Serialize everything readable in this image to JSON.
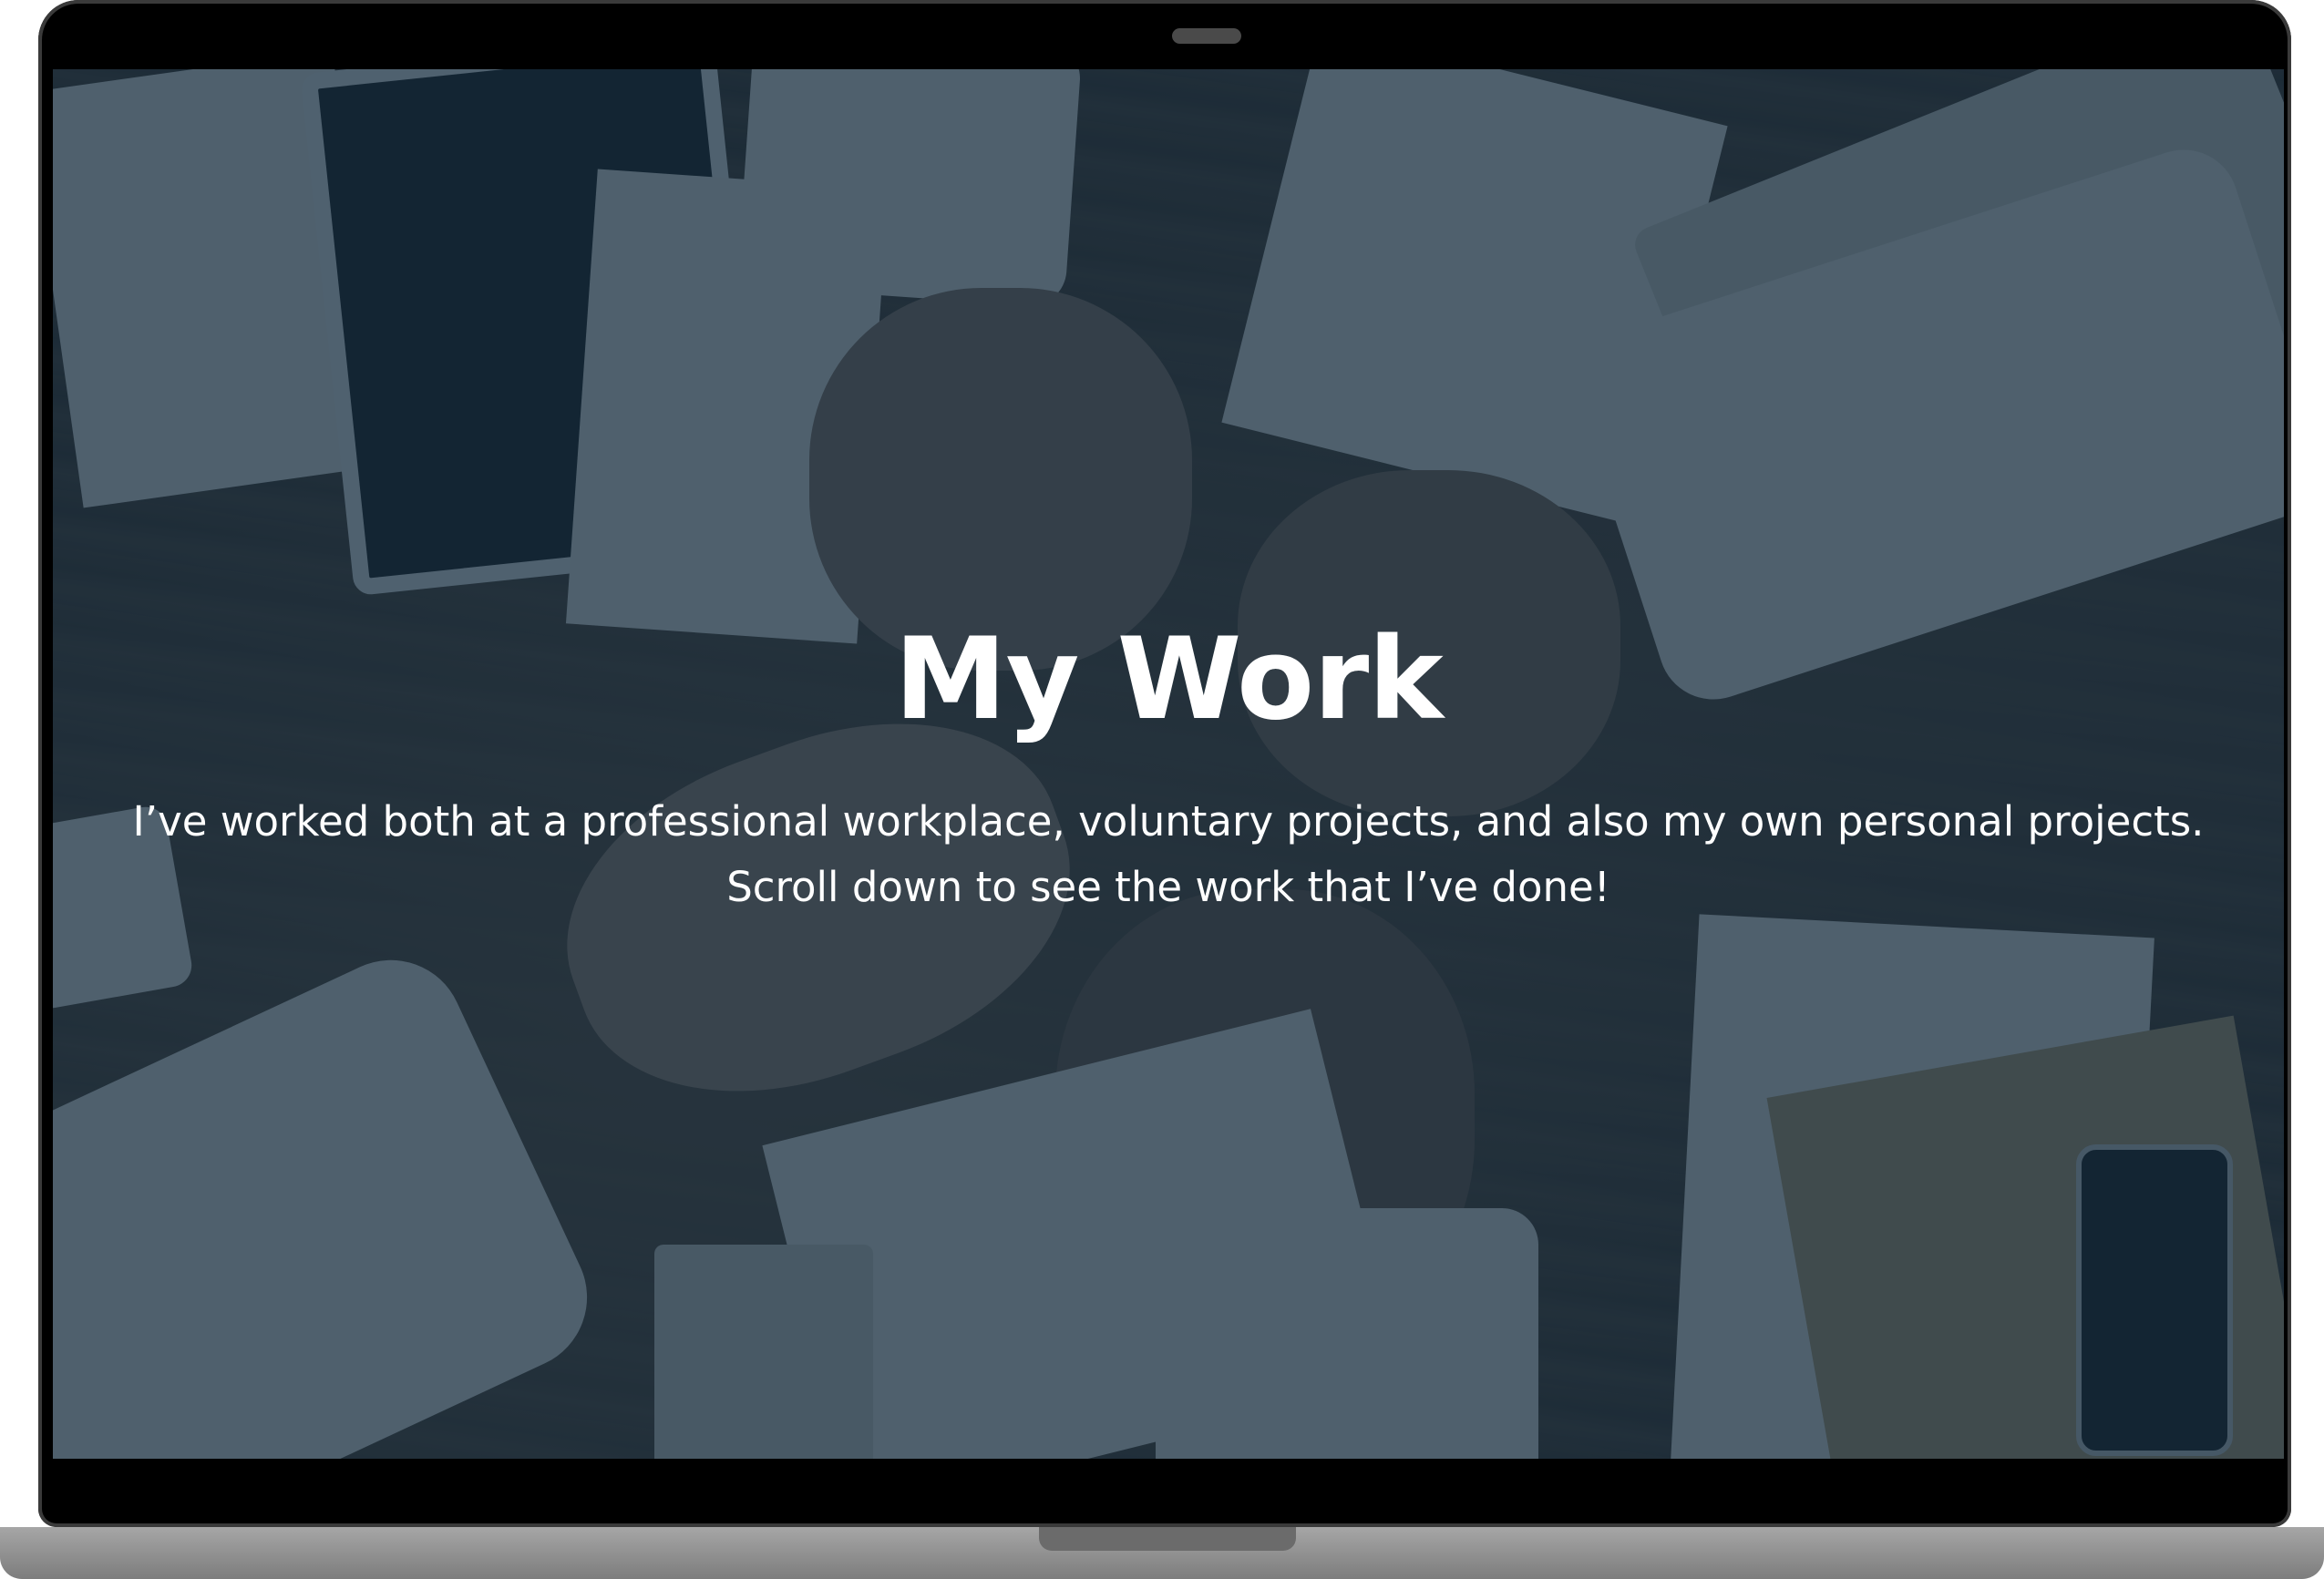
{
  "hero": {
    "title": "My Work",
    "subtitle_line1": "I’ve worked both at a professional workplace, voluntary projects, and also my own personal projects.",
    "subtitle_line2": "Scroll down to see the work that I’ve done!"
  },
  "colors": {
    "overlay": "#142c40",
    "bezel": "#000000",
    "text": "#ffffff"
  },
  "icons": {
    "camera": "webcam-icon"
  }
}
